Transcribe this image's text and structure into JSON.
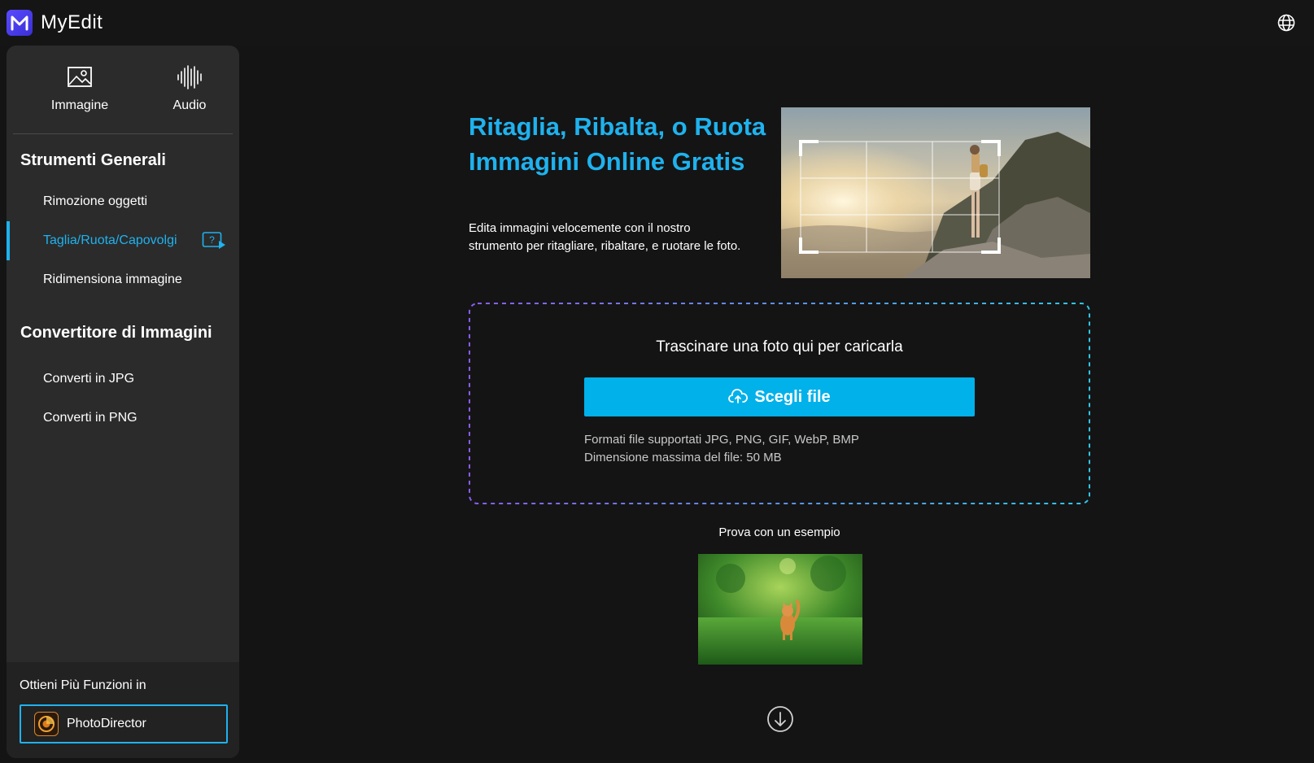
{
  "app": {
    "name": "MyEdit",
    "logo_letter": "M",
    "brand_color": "#4b3ff0",
    "accent_color": "#1fb2ee",
    "language_icon": "globe-icon"
  },
  "sidebar": {
    "modes": [
      {
        "label": "Immagine",
        "icon": "image-icon"
      },
      {
        "label": "Audio",
        "icon": "audio-waveform-icon"
      }
    ],
    "sections": [
      {
        "title": "Strumenti Generali",
        "items": [
          {
            "label": "Rimozione oggetti",
            "active": false
          },
          {
            "label": "Taglia/Ruota/Capovolgi",
            "active": true,
            "icon": "help-video-icon"
          },
          {
            "label": "Ridimensiona immagine",
            "active": false
          }
        ]
      },
      {
        "title": "Convertitore di Immagini",
        "items": [
          {
            "label": "Converti in JPG",
            "active": false
          },
          {
            "label": "Converti in PNG",
            "active": false
          }
        ]
      }
    ],
    "promo": {
      "title": "Ottieni Più Funzioni in",
      "button_label": "PhotoDirector",
      "button_icon": "photodirector-logo-icon"
    }
  },
  "main": {
    "hero": {
      "title": "Ritaglia, Ribalta, o Ruota Immagini Online Gratis",
      "description": "Edita immagini velocemente con il nostro strumento per ritagliare, ribaltare, e ruotare le foto.",
      "image": "crop-demo-mountain-woman"
    },
    "upload": {
      "drop_text": "Trascinare una foto qui per caricarla",
      "button_label": "Scegli file",
      "button_icon": "cloud-upload-icon",
      "formats_text": "Formati file supportati JPG, PNG, GIF, WebP, BMP",
      "max_size_text": "Dimensione massima del file: 50 MB",
      "button_color": "#00b1ea"
    },
    "sample": {
      "label": "Prova con un esempio",
      "image": "cat-in-grass"
    },
    "scroll_icon": "arrow-down-circle-icon"
  }
}
